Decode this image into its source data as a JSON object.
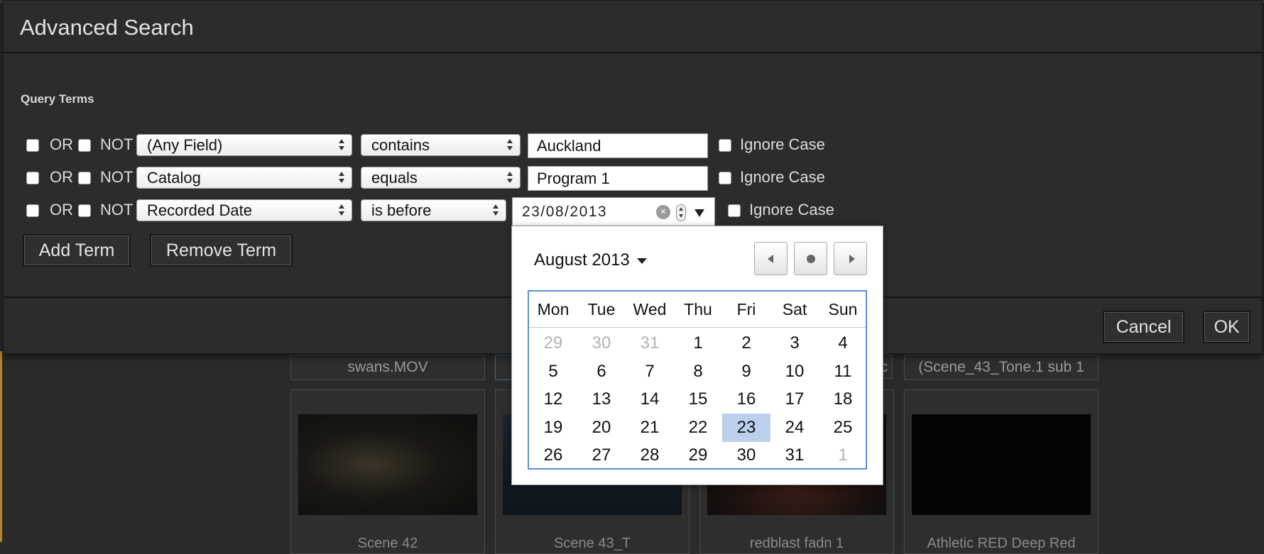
{
  "dialog": {
    "title": "Advanced Search",
    "section_label": "Query Terms",
    "or_label": "OR",
    "not_label": "NOT",
    "ignore_case_label": "Ignore Case",
    "terms": [
      {
        "field": "(Any Field)",
        "operator": "contains",
        "value": "Auckland"
      },
      {
        "field": "Catalog",
        "operator": "equals",
        "value": "Program 1"
      },
      {
        "field": "Recorded Date",
        "operator": "is before",
        "value": "23/08/2013"
      }
    ],
    "add_term_label": "Add Term",
    "remove_term_label": "Remove Term",
    "cancel_label": "Cancel",
    "ok_label": "OK"
  },
  "date_picker": {
    "month_label": "August 2013",
    "weekdays": [
      "Mon",
      "Tue",
      "Wed",
      "Thu",
      "Fri",
      "Sat",
      "Sun"
    ],
    "weeks": [
      [
        {
          "d": "29",
          "muted": true
        },
        {
          "d": "30",
          "muted": true
        },
        {
          "d": "31",
          "muted": true
        },
        {
          "d": "1"
        },
        {
          "d": "2"
        },
        {
          "d": "3"
        },
        {
          "d": "4"
        }
      ],
      [
        {
          "d": "5"
        },
        {
          "d": "6"
        },
        {
          "d": "7"
        },
        {
          "d": "8"
        },
        {
          "d": "9"
        },
        {
          "d": "10"
        },
        {
          "d": "11"
        }
      ],
      [
        {
          "d": "12"
        },
        {
          "d": "13"
        },
        {
          "d": "14"
        },
        {
          "d": "15"
        },
        {
          "d": "16"
        },
        {
          "d": "17"
        },
        {
          "d": "18"
        }
      ],
      [
        {
          "d": "19"
        },
        {
          "d": "20"
        },
        {
          "d": "21"
        },
        {
          "d": "22"
        },
        {
          "d": "23",
          "selected": true
        },
        {
          "d": "24"
        },
        {
          "d": "25"
        }
      ],
      [
        {
          "d": "26"
        },
        {
          "d": "27"
        },
        {
          "d": "28"
        },
        {
          "d": "29"
        },
        {
          "d": "30"
        },
        {
          "d": "31"
        },
        {
          "d": "1",
          "muted": true
        }
      ]
    ]
  },
  "background": {
    "captions": [
      "swans.MOV",
      "",
      "",
      "(Scene_43_Tone.1 sub 1"
    ],
    "partial_caption_tail": "c",
    "thumb_labels": [
      "Scene 42",
      "Scene 43_T",
      "redblast fadn 1",
      "Athletic RED Deep Red"
    ]
  }
}
